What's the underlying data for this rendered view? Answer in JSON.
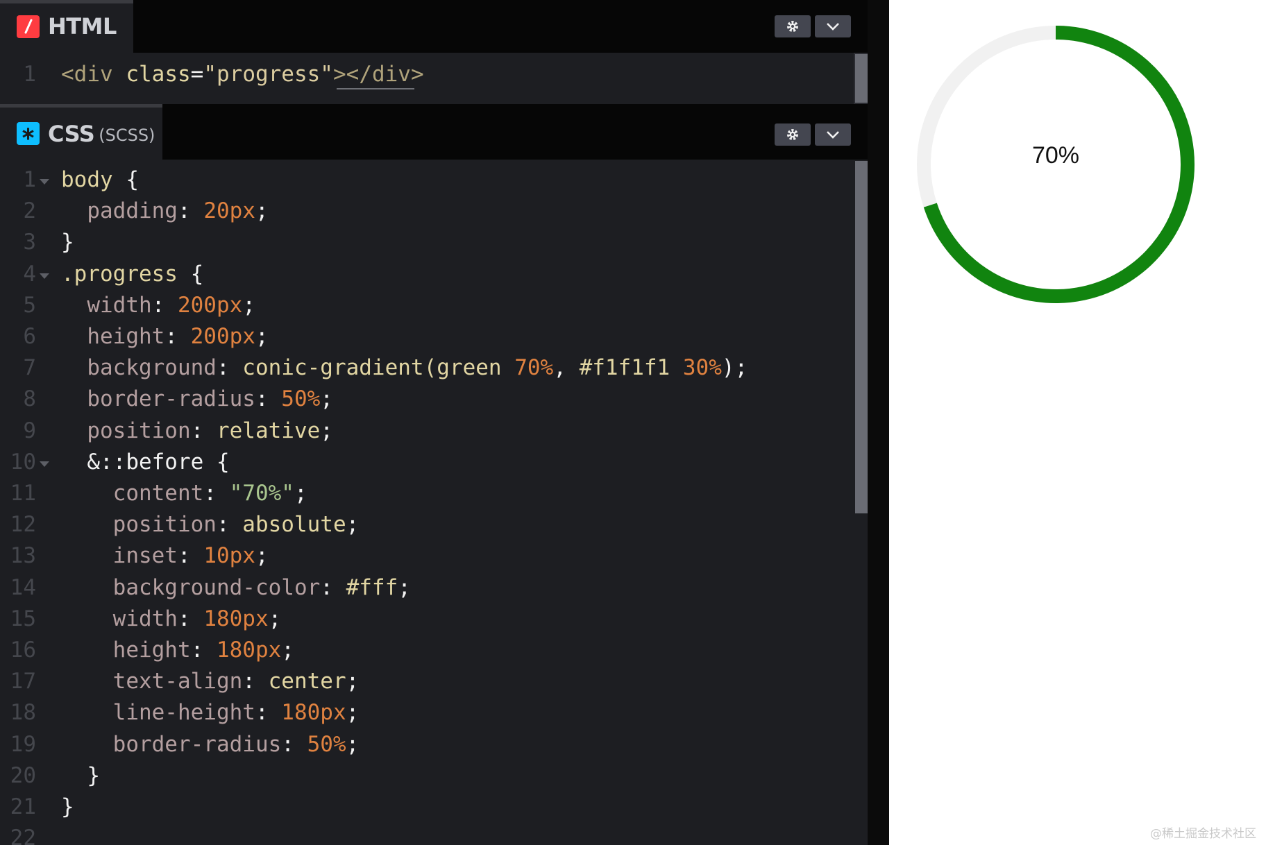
{
  "html_pane": {
    "title": "HTML",
    "icon": "slash-icon",
    "icon_color": "#ff3c41",
    "lines": [
      {
        "n": "1",
        "tokens": [
          [
            "k-tag",
            "<div "
          ],
          [
            "k-attr",
            "class"
          ],
          [
            "k-pun",
            "="
          ],
          [
            "k-hstr",
            "\"progress\""
          ],
          [
            "k-tag",
            "></div>"
          ]
        ]
      }
    ]
  },
  "css_pane": {
    "title": "CSS",
    "subtitle": "(SCSS)",
    "icon": "asterisk-icon",
    "icon_color": "#0ebeff",
    "lines": [
      {
        "n": "1",
        "fold": true,
        "tokens": [
          [
            "k-sel",
            "body"
          ],
          [
            "k-pun",
            " {"
          ]
        ]
      },
      {
        "n": "2",
        "tokens": [
          [
            "k-prop",
            "  padding"
          ],
          [
            "k-pun",
            ": "
          ],
          [
            "k-num",
            "20px"
          ],
          [
            "k-pun",
            ";"
          ]
        ]
      },
      {
        "n": "3",
        "tokens": [
          [
            "k-pun",
            "}"
          ]
        ]
      },
      {
        "n": "4",
        "fold": true,
        "tokens": [
          [
            "k-sel",
            ".progress"
          ],
          [
            "k-pun",
            " {"
          ]
        ]
      },
      {
        "n": "5",
        "tokens": [
          [
            "k-prop",
            "  width"
          ],
          [
            "k-pun",
            ": "
          ],
          [
            "k-num",
            "200px"
          ],
          [
            "k-pun",
            ";"
          ]
        ]
      },
      {
        "n": "6",
        "tokens": [
          [
            "k-prop",
            "  height"
          ],
          [
            "k-pun",
            ": "
          ],
          [
            "k-num",
            "200px"
          ],
          [
            "k-pun",
            ";"
          ]
        ]
      },
      {
        "n": "7",
        "tokens": [
          [
            "k-prop",
            "  background"
          ],
          [
            "k-pun",
            ": "
          ],
          [
            "k-val",
            "conic-gradient(green "
          ],
          [
            "k-num",
            "70%"
          ],
          [
            "k-pun",
            ", "
          ],
          [
            "k-val",
            "#f1f1f1 "
          ],
          [
            "k-num",
            "30%"
          ],
          [
            "k-pun",
            ");"
          ]
        ]
      },
      {
        "n": "8",
        "tokens": [
          [
            "k-prop",
            "  border-radius"
          ],
          [
            "k-pun",
            ": "
          ],
          [
            "k-num",
            "50%"
          ],
          [
            "k-pun",
            ";"
          ]
        ]
      },
      {
        "n": "9",
        "tokens": [
          [
            "k-prop",
            "  position"
          ],
          [
            "k-pun",
            ": "
          ],
          [
            "k-val",
            "relative"
          ],
          [
            "k-pun",
            ";"
          ]
        ]
      },
      {
        "n": "10",
        "fold": true,
        "tokens": [
          [
            "k-pun",
            "  &::before {"
          ]
        ]
      },
      {
        "n": "11",
        "tokens": [
          [
            "k-prop",
            "    content"
          ],
          [
            "k-pun",
            ": "
          ],
          [
            "k-str",
            "\"70%\""
          ],
          [
            "k-pun",
            ";"
          ]
        ]
      },
      {
        "n": "12",
        "tokens": [
          [
            "k-prop",
            "    position"
          ],
          [
            "k-pun",
            ": "
          ],
          [
            "k-val",
            "absolute"
          ],
          [
            "k-pun",
            ";"
          ]
        ]
      },
      {
        "n": "13",
        "tokens": [
          [
            "k-prop",
            "    inset"
          ],
          [
            "k-pun",
            ": "
          ],
          [
            "k-num",
            "10px"
          ],
          [
            "k-pun",
            ";"
          ]
        ]
      },
      {
        "n": "14",
        "tokens": [
          [
            "k-prop",
            "    background-color"
          ],
          [
            "k-pun",
            ": "
          ],
          [
            "k-val",
            "#fff"
          ],
          [
            "k-pun",
            ";"
          ]
        ]
      },
      {
        "n": "15",
        "tokens": [
          [
            "k-prop",
            "    width"
          ],
          [
            "k-pun",
            ": "
          ],
          [
            "k-num",
            "180px"
          ],
          [
            "k-pun",
            ";"
          ]
        ]
      },
      {
        "n": "16",
        "tokens": [
          [
            "k-prop",
            "    height"
          ],
          [
            "k-pun",
            ": "
          ],
          [
            "k-num",
            "180px"
          ],
          [
            "k-pun",
            ";"
          ]
        ]
      },
      {
        "n": "17",
        "tokens": [
          [
            "k-prop",
            "    text-align"
          ],
          [
            "k-pun",
            ": "
          ],
          [
            "k-val",
            "center"
          ],
          [
            "k-pun",
            ";"
          ]
        ]
      },
      {
        "n": "18",
        "tokens": [
          [
            "k-prop",
            "    line-height"
          ],
          [
            "k-pun",
            ": "
          ],
          [
            "k-num",
            "180px"
          ],
          [
            "k-pun",
            ";"
          ]
        ]
      },
      {
        "n": "19",
        "tokens": [
          [
            "k-prop",
            "    border-radius"
          ],
          [
            "k-pun",
            ": "
          ],
          [
            "k-num",
            "50%"
          ],
          [
            "k-pun",
            ";"
          ]
        ]
      },
      {
        "n": "20",
        "tokens": [
          [
            "k-pun",
            "  }"
          ]
        ]
      },
      {
        "n": "21",
        "tokens": [
          [
            "k-pun",
            "}"
          ]
        ]
      },
      {
        "n": "22",
        "tokens": []
      }
    ]
  },
  "buttons": {
    "settings_icon": "gear-icon",
    "collapse_icon": "chevron-down-icon"
  },
  "preview": {
    "progress_label": "70%",
    "progress_fraction": 0.7,
    "fill_color": "#11840f",
    "track_color": "#f1f1f1"
  },
  "watermark": "@稀土掘金技术社区"
}
